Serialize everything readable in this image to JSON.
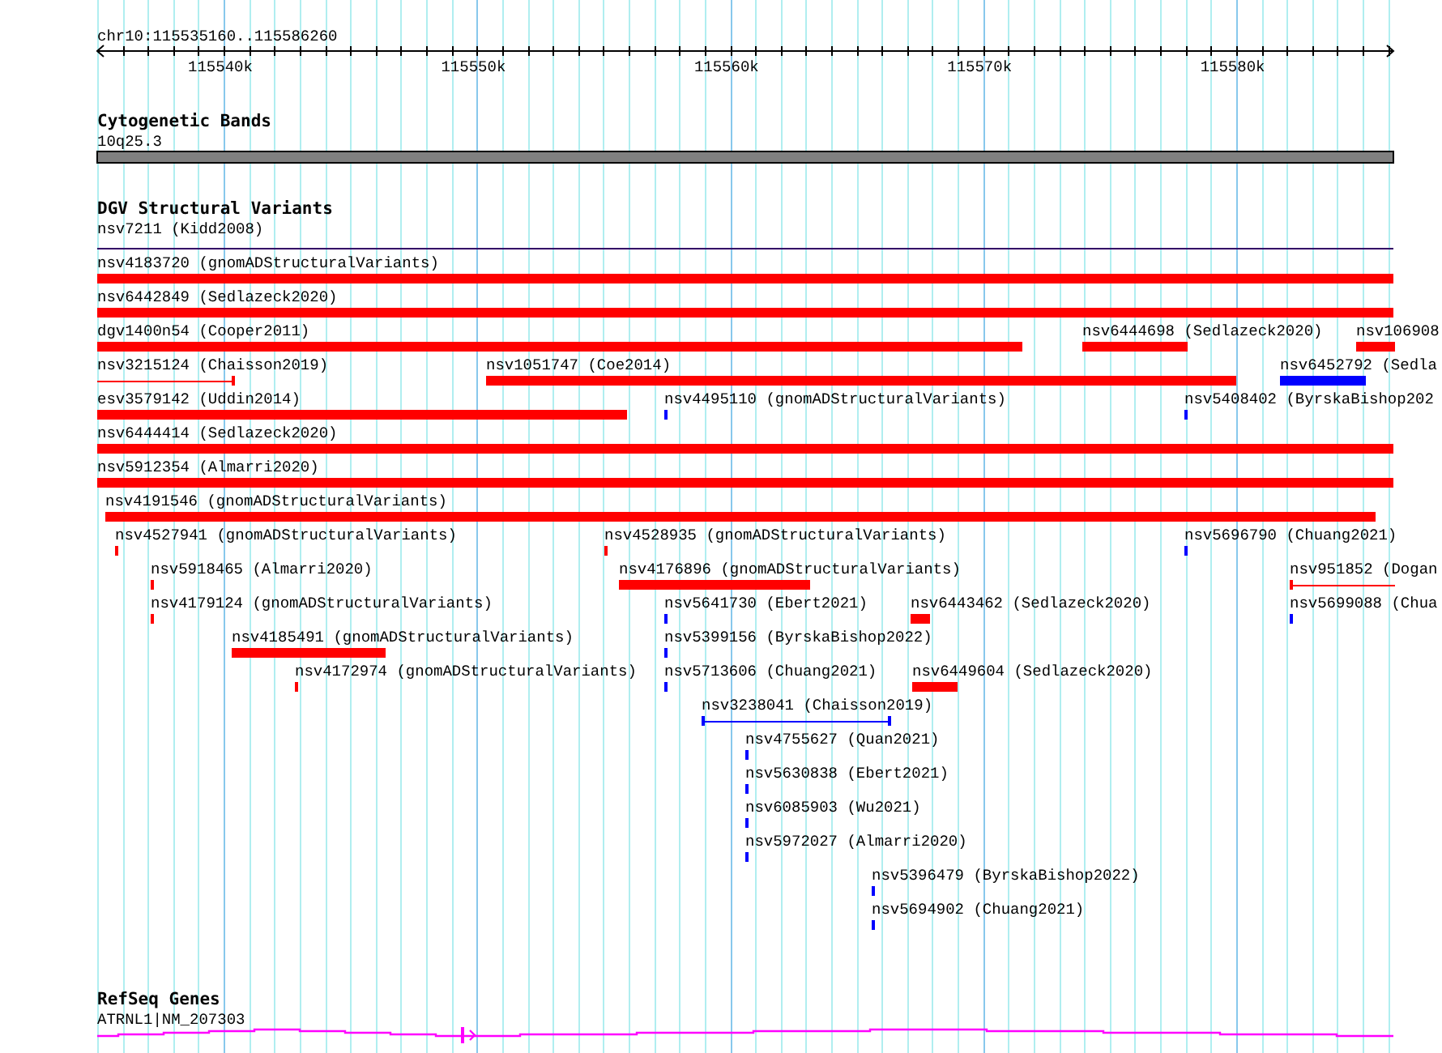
{
  "ruler": {
    "location": "chr10:115535160..115586260",
    "ticks": [
      "115540k",
      "115550k",
      "115560k",
      "115570k",
      "115580k"
    ]
  },
  "tracks": [
    {
      "kind": "bands",
      "title": "Cytogenetic Bands",
      "features": [
        {
          "label": "10q25.3",
          "kind": "band",
          "color": "#808080"
        }
      ]
    },
    {
      "kind": "variants",
      "title": "DGV Structural Variants",
      "rows": [
        {
          "features": [
            {
              "label": "nsv7211 (Kidd2008)",
              "kind": "line",
              "color": "#330066"
            }
          ]
        },
        {
          "features": [
            {
              "label": "nsv4183720 (gnomADStructuralVariants)",
              "kind": "bar",
              "color": "#ff0000"
            }
          ]
        },
        {
          "features": [
            {
              "label": "nsv6442849 (Sedlazeck2020)",
              "kind": "bar",
              "color": "#ff0000"
            }
          ]
        },
        {
          "features": [
            {
              "label": "dgv1400n54 (Cooper2011)",
              "kind": "bar",
              "color": "#ff0000"
            },
            {
              "label": "nsv6444698 (Sedlazeck2020)",
              "kind": "bar",
              "color": "#ff0000"
            },
            {
              "label": "nsv106908",
              "kind": "bar",
              "color": "#ff0000"
            }
          ]
        },
        {
          "features": [
            {
              "label": "nsv3215124 (Chaisson2019)",
              "kind": "span",
              "color": "#ff0000"
            },
            {
              "label": "nsv1051747 (Coe2014)",
              "kind": "bar",
              "color": "#ff0000"
            },
            {
              "label": "nsv6452792 (Sedla",
              "kind": "bar",
              "color": "#0000ff"
            }
          ]
        },
        {
          "features": [
            {
              "label": "esv3579142 (Uddin2014)",
              "kind": "bar",
              "color": "#ff0000"
            },
            {
              "label": "nsv4495110 (gnomADStructuralVariants)",
              "kind": "bar",
              "color": "#0000ff"
            },
            {
              "label": "nsv5408402 (ByrskaBishop202",
              "kind": "bar",
              "color": "#0000ff"
            }
          ]
        },
        {
          "features": [
            {
              "label": "nsv6444414 (Sedlazeck2020)",
              "kind": "bar",
              "color": "#ff0000"
            }
          ]
        },
        {
          "features": [
            {
              "label": "nsv5912354 (Almarri2020)",
              "kind": "bar",
              "color": "#ff0000"
            }
          ]
        },
        {
          "features": [
            {
              "label": "nsv4191546 (gnomADStructuralVariants)",
              "kind": "bar",
              "color": "#ff0000"
            }
          ]
        },
        {
          "features": [
            {
              "label": "nsv4527941 (gnomADStructuralVariants)",
              "kind": "bar",
              "color": "#ff0000"
            },
            {
              "label": "nsv4528935 (gnomADStructuralVariants)",
              "kind": "bar",
              "color": "#ff0000"
            },
            {
              "label": "nsv5696790 (Chuang2021)",
              "kind": "bar",
              "color": "#0000ff"
            }
          ]
        },
        {
          "features": [
            {
              "label": "nsv5918465 (Almarri2020)",
              "kind": "bar",
              "color": "#ff0000"
            },
            {
              "label": "nsv4176896 (gnomADStructuralVariants)",
              "kind": "bar",
              "color": "#ff0000"
            },
            {
              "label": "nsv951852 (Dogan",
              "kind": "span",
              "color": "#ff0000"
            }
          ]
        },
        {
          "features": [
            {
              "label": "nsv4179124 (gnomADStructuralVariants)",
              "kind": "bar",
              "color": "#ff0000"
            },
            {
              "label": "nsv5641730 (Ebert2021)",
              "kind": "bar",
              "color": "#0000ff"
            },
            {
              "label": "nsv6443462 (Sedlazeck2020)",
              "kind": "bar",
              "color": "#ff0000"
            },
            {
              "label": "nsv5699088 (Chua",
              "kind": "bar",
              "color": "#0000ff"
            }
          ]
        },
        {
          "features": [
            {
              "label": "nsv4185491 (gnomADStructuralVariants)",
              "kind": "bar",
              "color": "#ff0000"
            },
            {
              "label": "nsv5399156 (ByrskaBishop2022)",
              "kind": "bar",
              "color": "#0000ff"
            }
          ]
        },
        {
          "features": [
            {
              "label": "nsv4172974 (gnomADStructuralVariants)",
              "kind": "bar",
              "color": "#ff0000"
            },
            {
              "label": "nsv5713606 (Chuang2021)",
              "kind": "bar",
              "color": "#0000ff"
            },
            {
              "label": "nsv6449604 (Sedlazeck2020)",
              "kind": "bar",
              "color": "#ff0000"
            }
          ]
        },
        {
          "features": [
            {
              "label": "nsv3238041 (Chaisson2019)",
              "kind": "span",
              "color": "#0000ff"
            }
          ]
        },
        {
          "features": [
            {
              "label": "nsv4755627 (Quan2021)",
              "kind": "bar",
              "color": "#0000ff"
            }
          ]
        },
        {
          "features": [
            {
              "label": "nsv5630838 (Ebert2021)",
              "kind": "bar",
              "color": "#0000ff"
            }
          ]
        },
        {
          "features": [
            {
              "label": "nsv6085903 (Wu2021)",
              "kind": "bar",
              "color": "#0000ff"
            }
          ]
        },
        {
          "features": [
            {
              "label": "nsv5972027 (Almarri2020)",
              "kind": "bar",
              "color": "#0000ff"
            }
          ]
        },
        {
          "features": [
            {
              "label": "nsv5396479 (ByrskaBishop2022)",
              "kind": "bar",
              "color": "#0000ff"
            }
          ]
        },
        {
          "features": [
            {
              "label": "nsv5694902 (Chuang2021)",
              "kind": "bar",
              "color": "#0000ff"
            }
          ]
        }
      ]
    },
    {
      "kind": "genes",
      "title": "RefSeq Genes",
      "features": [
        {
          "label": "ATRNL1|NM_207303",
          "kind": "gene",
          "color": "#ff00ff"
        }
      ]
    }
  ]
}
